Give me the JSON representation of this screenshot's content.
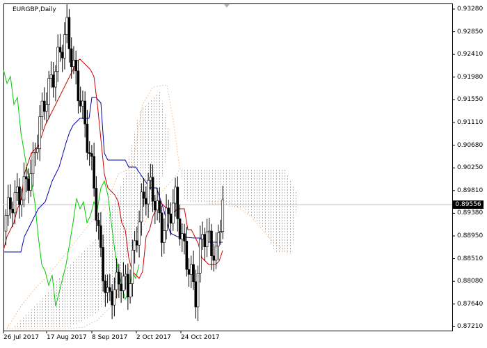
{
  "chart": {
    "symbol_label": "EURGBP,Daily",
    "current_price": "0.89556",
    "price_labels": [
      "0.93280",
      "0.92850",
      "0.92410",
      "0.91980",
      "0.91550",
      "0.91110",
      "0.90680",
      "0.90250",
      "0.89810",
      "0.89380",
      "0.88950",
      "0.88510",
      "0.88080",
      "0.87640",
      "0.87210"
    ],
    "date_labels": [
      "26 Jul 2017",
      "17 Aug 2017",
      "8 Sep 2017",
      "2 Oct 2017",
      "24 Oct 2017"
    ],
    "colors": {
      "bull_candle": "#000000",
      "bear_candle": "#000000",
      "tenkan": "#cc0000",
      "kijun": "#0000aa",
      "chikou": "#00cc00",
      "senkou_span_a": "#f4a460",
      "senkou_span_b": "#d8c8d0",
      "grid": "#c8c8c8"
    }
  },
  "chart_data": {
    "type": "candlestick",
    "title": "EURGBP,Daily",
    "ylim": [
      0.871,
      0.9335
    ],
    "x": [
      "26 Jul 2017",
      "17 Aug 2017",
      "8 Sep 2017",
      "2 Oct 2017",
      "24 Oct 2017"
    ],
    "close_price": 0.89556,
    "series": [
      {
        "name": "",
        "values": [
          0.893,
          0.8958,
          0.8968,
          0.899,
          0.9025,
          0.911,
          0.916,
          0.9198,
          0.9241,
          0.9285,
          0.921,
          0.915,
          0.9075,
          0.899,
          0.885,
          0.877,
          0.879,
          0.881,
          0.879,
          0.887,
          0.895,
          0.899,
          0.896,
          0.89,
          0.893,
          0.896,
          0.888,
          0.883,
          0.878,
          0.89,
          0.888,
          0.885,
          0.896
        ]
      }
    ]
  }
}
